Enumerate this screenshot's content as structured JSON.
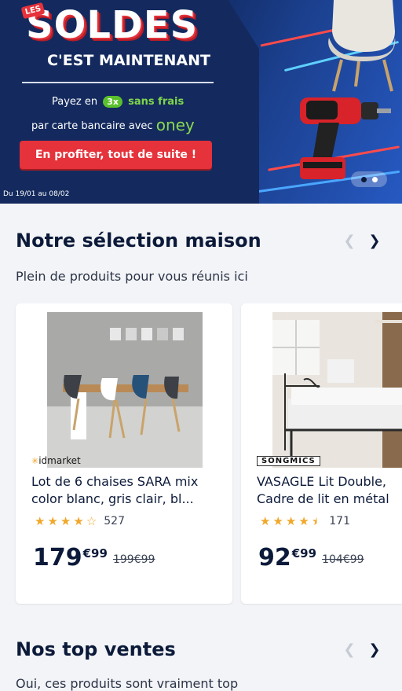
{
  "hero": {
    "badge": "LES",
    "headline": "SOLDES",
    "subheadline": "C'EST MAINTENANT",
    "pay_prefix": "Payez en",
    "pay_installments": "3x",
    "pay_free": "sans frais",
    "pay_line2": "par carte bancaire avec",
    "partner": "oney",
    "cta_label": "En profiter, tout de suite !",
    "dates": "Du 19/01 au 08/02",
    "slides_total": 2,
    "slide_active": 1,
    "colors": {
      "accent_red": "#e5323b",
      "oney_green": "#8ad94f",
      "navy": "#142a5e"
    }
  },
  "selection": {
    "title": "Notre sélection maison",
    "subtitle": "Plein de produits pour vous réunis ici",
    "prev_icon": "chevron-left-icon",
    "next_icon": "chevron-right-icon",
    "products": [
      {
        "brand": "idmarket",
        "title_line1": "Lot de 6 chaises SARA mix",
        "title_line2": "color blanc, gris clair, bl...",
        "rating": 4,
        "reviews": "527",
        "price_int": "179",
        "price_cents": "€99",
        "price_old": "199€99"
      },
      {
        "brand": "SONGMICS",
        "title_line1": "VASAGLE Lit Double,",
        "title_line2": "Cadre de lit en métal",
        "rating": 4.5,
        "reviews": "171",
        "price_int": "92",
        "price_cents": "€99",
        "price_old": "104€99"
      }
    ]
  },
  "top_ventes": {
    "title": "Nos top ventes",
    "subtitle": "Oui, ces produits sont vraiment top"
  }
}
